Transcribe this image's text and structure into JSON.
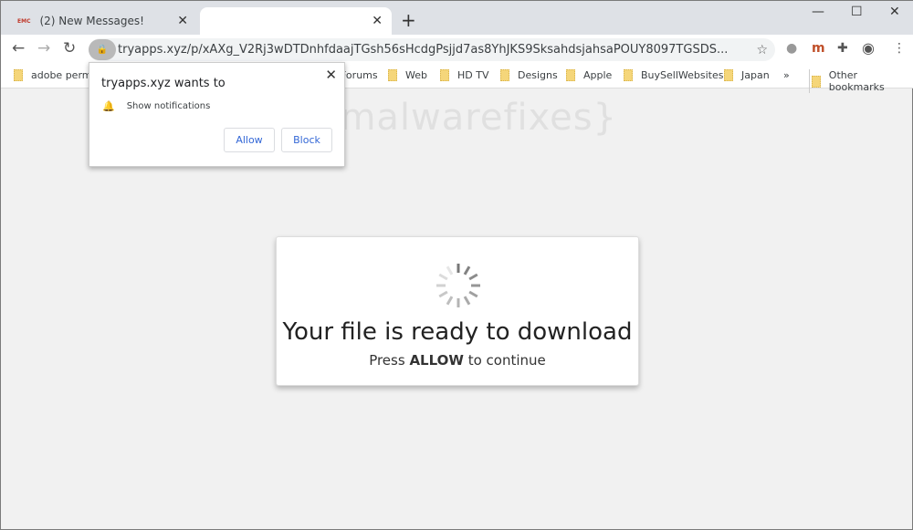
{
  "tabs": [
    {
      "label": "(2) New Messages!",
      "favicon": "EMC"
    },
    {
      "label": ""
    }
  ],
  "window_controls": {
    "minimize": "—",
    "maximize": "☐",
    "close": "✕"
  },
  "toolbar": {
    "url": "tryapps.xyz/p/xAXg_V2Rj3wDTDnhfdaajTGsh56sHcdgPsjjd7as8YhJKS9SksahdsjahsaPOUY8097TGSDS..."
  },
  "bookmarks": [
    "adobe permie",
    "Forums",
    "Web",
    "HD TV",
    "Designs",
    "Apple",
    "BuySellWebsites",
    "Japan"
  ],
  "bookmarks_overflow": "»",
  "other_bookmarks": "Other bookmarks",
  "popup": {
    "title": "tryapps.xyz wants to",
    "permission": "Show notifications",
    "allow": "Allow",
    "block": "Block"
  },
  "watermark": "{malwarefixes}",
  "card": {
    "heading": "Your file is ready to download",
    "press": "Press",
    "allow": "ALLOW",
    "continue": "to continue"
  }
}
